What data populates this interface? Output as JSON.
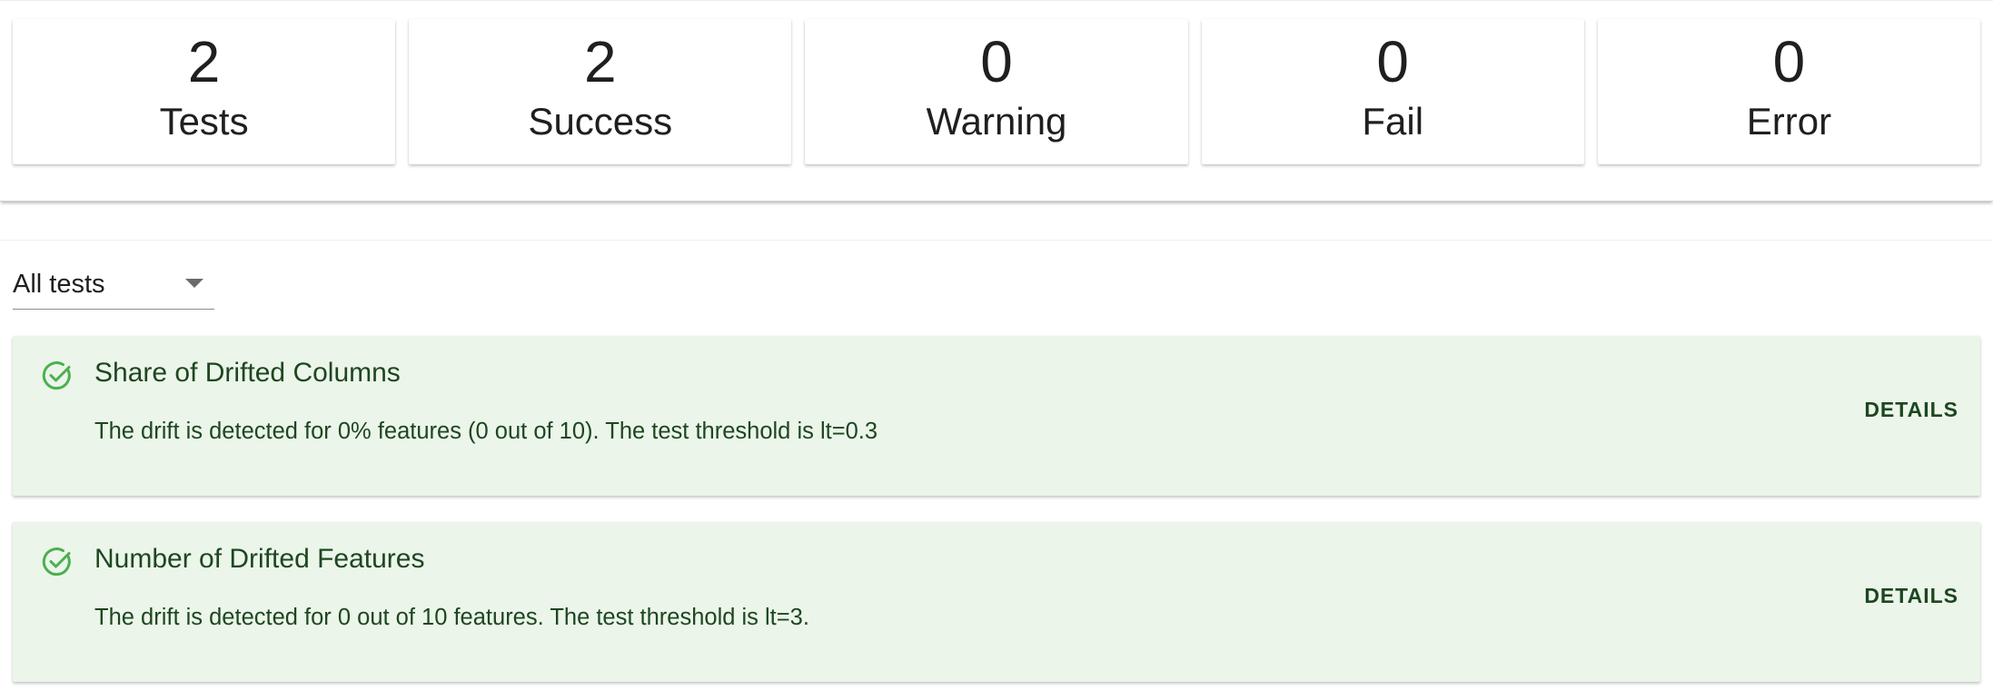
{
  "summary": {
    "cards": [
      {
        "count": "2",
        "label": "Tests"
      },
      {
        "count": "2",
        "label": "Success"
      },
      {
        "count": "0",
        "label": "Warning"
      },
      {
        "count": "0",
        "label": "Fail"
      },
      {
        "count": "0",
        "label": "Error"
      }
    ]
  },
  "filter": {
    "selected": "All tests",
    "icon": "chevron-down-icon"
  },
  "tests": [
    {
      "status": "success",
      "icon": "check-circle-icon",
      "title": "Share of Drifted Columns",
      "description": "The drift is detected for 0% features (0 out of 10). The test threshold is lt=0.3",
      "details_label": "DETAILS"
    },
    {
      "status": "success",
      "icon": "check-circle-icon",
      "title": "Number of Drifted Features",
      "description": "The drift is detected for 0 out of 10 features. The test threshold is lt=3.",
      "details_label": "DETAILS"
    }
  ],
  "colors": {
    "success_background": "#ebf5ea",
    "success_text": "#1e4620",
    "success_icon": "#4caf50"
  }
}
